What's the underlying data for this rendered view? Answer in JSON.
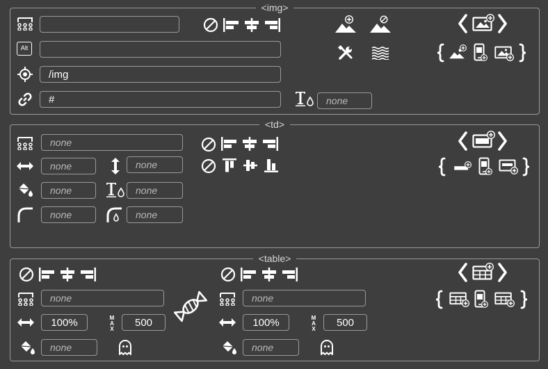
{
  "img_section": {
    "legend": "<img>",
    "class_field": {
      "value": "",
      "placeholder": ""
    },
    "alt_field": {
      "value": "",
      "placeholder": ""
    },
    "alt_icon_text": "Alt",
    "src_field": {
      "value": "/img",
      "placeholder": ""
    },
    "href_field": {
      "value": "#",
      "placeholder": ""
    },
    "text_color_field": {
      "value": "",
      "placeholder": "none"
    }
  },
  "td_section": {
    "legend": "<td>",
    "class_field": {
      "value": "",
      "placeholder": "none"
    },
    "width_field": {
      "value": "",
      "placeholder": "none"
    },
    "height_field": {
      "value": "",
      "placeholder": "none"
    },
    "bg_color_field": {
      "value": "",
      "placeholder": "none"
    },
    "text_color_field": {
      "value": "",
      "placeholder": "none"
    },
    "radius_field": {
      "value": "",
      "placeholder": "none"
    },
    "radius_color_field": {
      "value": "",
      "placeholder": "none"
    }
  },
  "table_section": {
    "legend": "<table>",
    "left": {
      "class_field": {
        "value": "",
        "placeholder": "none"
      },
      "width_field": {
        "value": "100%",
        "placeholder": ""
      },
      "max_field": {
        "value": "500",
        "placeholder": ""
      },
      "bg_color_field": {
        "value": "",
        "placeholder": "none"
      }
    },
    "right": {
      "class_field": {
        "value": "",
        "placeholder": "none"
      },
      "width_field": {
        "value": "100%",
        "placeholder": ""
      },
      "max_field": {
        "value": "500",
        "placeholder": ""
      },
      "bg_color_field": {
        "value": "",
        "placeholder": "none"
      }
    },
    "max_label_letters": [
      "M",
      "A",
      "X"
    ]
  },
  "colors": {
    "background": "#3e3e3e",
    "border": "#9a9a9a",
    "icon": "#ffffff",
    "placeholder": "#b8b8b8"
  }
}
